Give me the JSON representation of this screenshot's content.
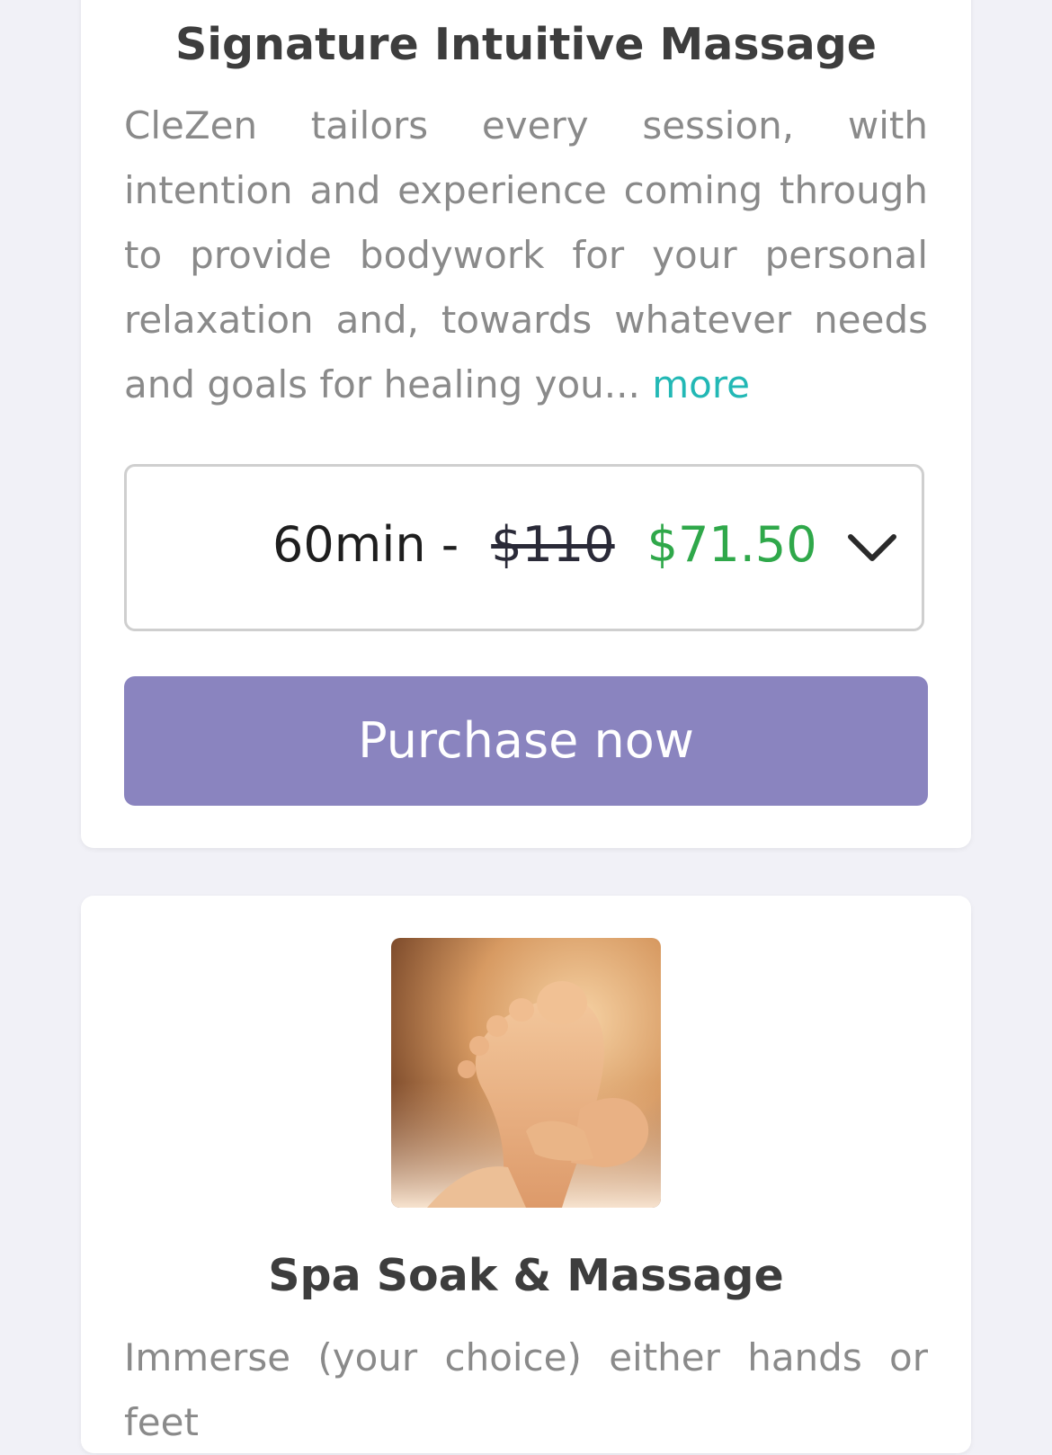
{
  "services": [
    {
      "title": "Signature Intuitive Massage",
      "description": "CleZen tailors every session, with intention and experience coming through to provide bodywork for your personal relaxation and, towards whatever needs and goals for healing you...",
      "more_label": "more",
      "option": {
        "duration": "60min -",
        "original_price": "$110",
        "sale_price": "$71.50"
      },
      "purchase_label": "Purchase now"
    },
    {
      "title": "Spa Soak & Massage",
      "description": "Immerse (your choice) either hands or feet"
    }
  ],
  "colors": {
    "accent_purple": "#8a84bf",
    "sale_green": "#2fa84a",
    "link_teal": "#22b8b5",
    "background": "#f1f1f7"
  },
  "icons": {
    "dropdown": "chevron-down-icon"
  }
}
